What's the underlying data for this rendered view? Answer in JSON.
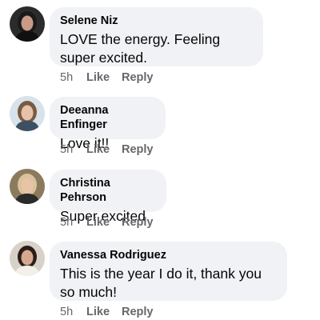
{
  "comments": [
    {
      "author": "Selene Niz",
      "text": "LOVE the energy. Feeling super excited.",
      "time": "5h",
      "like_label": "Like",
      "reply_label": "Reply",
      "avatar": {
        "bg": "#2b2b2b",
        "hair": "#1a1a1a",
        "skin": "#c99b86",
        "top": "#101010"
      }
    },
    {
      "author": "Deeanna Enfinger",
      "text": "Love it!!",
      "time": "5h",
      "like_label": "Like",
      "reply_label": "Reply",
      "avatar": {
        "bg": "#d7e2ea",
        "hair": "#7a5a40",
        "skin": "#e6c2aa",
        "top": "#3d4f63"
      }
    },
    {
      "author": "Christina Pehrson",
      "text": "Super excited",
      "time": "5h",
      "like_label": "Like",
      "reply_label": "Reply",
      "avatar": {
        "bg": "#8c7a5e",
        "hair": "#d9c39a",
        "skin": "#e7c4a8",
        "top": "#2a2a2a"
      }
    },
    {
      "author": "Vanessa Rodriguez",
      "text": "This is the year I do it, thank you so much!",
      "time": "5h",
      "like_label": "Like",
      "reply_label": "Reply",
      "avatar": {
        "bg": "#d8d1c8",
        "hair": "#2c1e16",
        "skin": "#d6a98e",
        "top": "#f3efe9"
      }
    }
  ]
}
